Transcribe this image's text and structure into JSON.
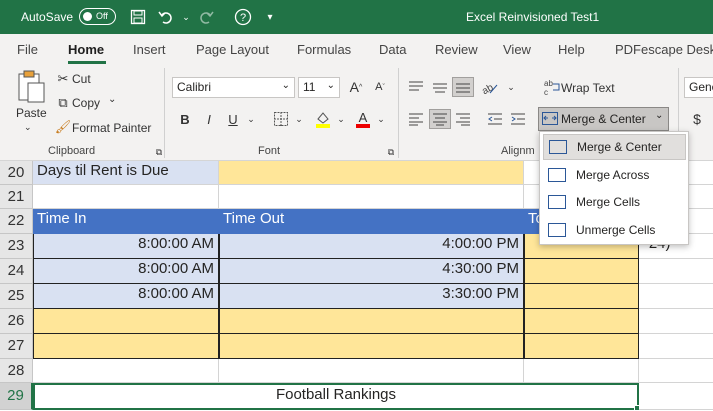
{
  "titlebar": {
    "autosave_label": "AutoSave",
    "autosave_state": "Off",
    "doc_title": "Excel Reinvisioned Test1"
  },
  "tabs": [
    "File",
    "Home",
    "Insert",
    "Page Layout",
    "Formulas",
    "Data",
    "Review",
    "View",
    "Help",
    "PDFescape Deskt"
  ],
  "ribbon": {
    "paste": "Paste",
    "cut": "Cut",
    "copy": "Copy",
    "format_painter": "Format Painter",
    "clipboard": "Clipboard",
    "font_name": "Calibri",
    "font_size": "11",
    "font": "Font",
    "bold": "B",
    "italic": "I",
    "underline": "U",
    "wrap_text": "Wrap Text",
    "merge_center": "Merge & Center",
    "alignment": "Alignm",
    "number_format": "Gene",
    "currency": "$"
  },
  "grid": {
    "rows": [
      {
        "num": "20",
        "a": "Days til Rent is Due",
        "b": "",
        "c": ""
      },
      {
        "num": "21",
        "a": "",
        "b": "",
        "c": ""
      },
      {
        "num": "22",
        "a": "Time In",
        "b": "Time Out",
        "c": "To"
      },
      {
        "num": "23",
        "a": "8:00:00 AM",
        "b": "4:00:00 PM",
        "c": "",
        "d": "*24)"
      },
      {
        "num": "24",
        "a": "8:00:00 AM",
        "b": "4:30:00 PM",
        "c": ""
      },
      {
        "num": "25",
        "a": "8:00:00 AM",
        "b": "3:30:00 PM",
        "c": ""
      },
      {
        "num": "26",
        "a": "",
        "b": "",
        "c": ""
      },
      {
        "num": "27",
        "a": "",
        "b": "",
        "c": ""
      },
      {
        "num": "28",
        "a": "",
        "b": "",
        "c": ""
      },
      {
        "num": "29",
        "a": "Football Rankings",
        "b": "",
        "c": ""
      }
    ]
  },
  "merge_menu": {
    "items": [
      "Merge & Center",
      "Merge Across",
      "Merge Cells",
      "Unmerge Cells"
    ]
  },
  "colors": {
    "brand_green": "#217346",
    "header_blue": "#4472c4",
    "light_blue": "#d9e1f2",
    "light_yellow": "#ffe699"
  }
}
